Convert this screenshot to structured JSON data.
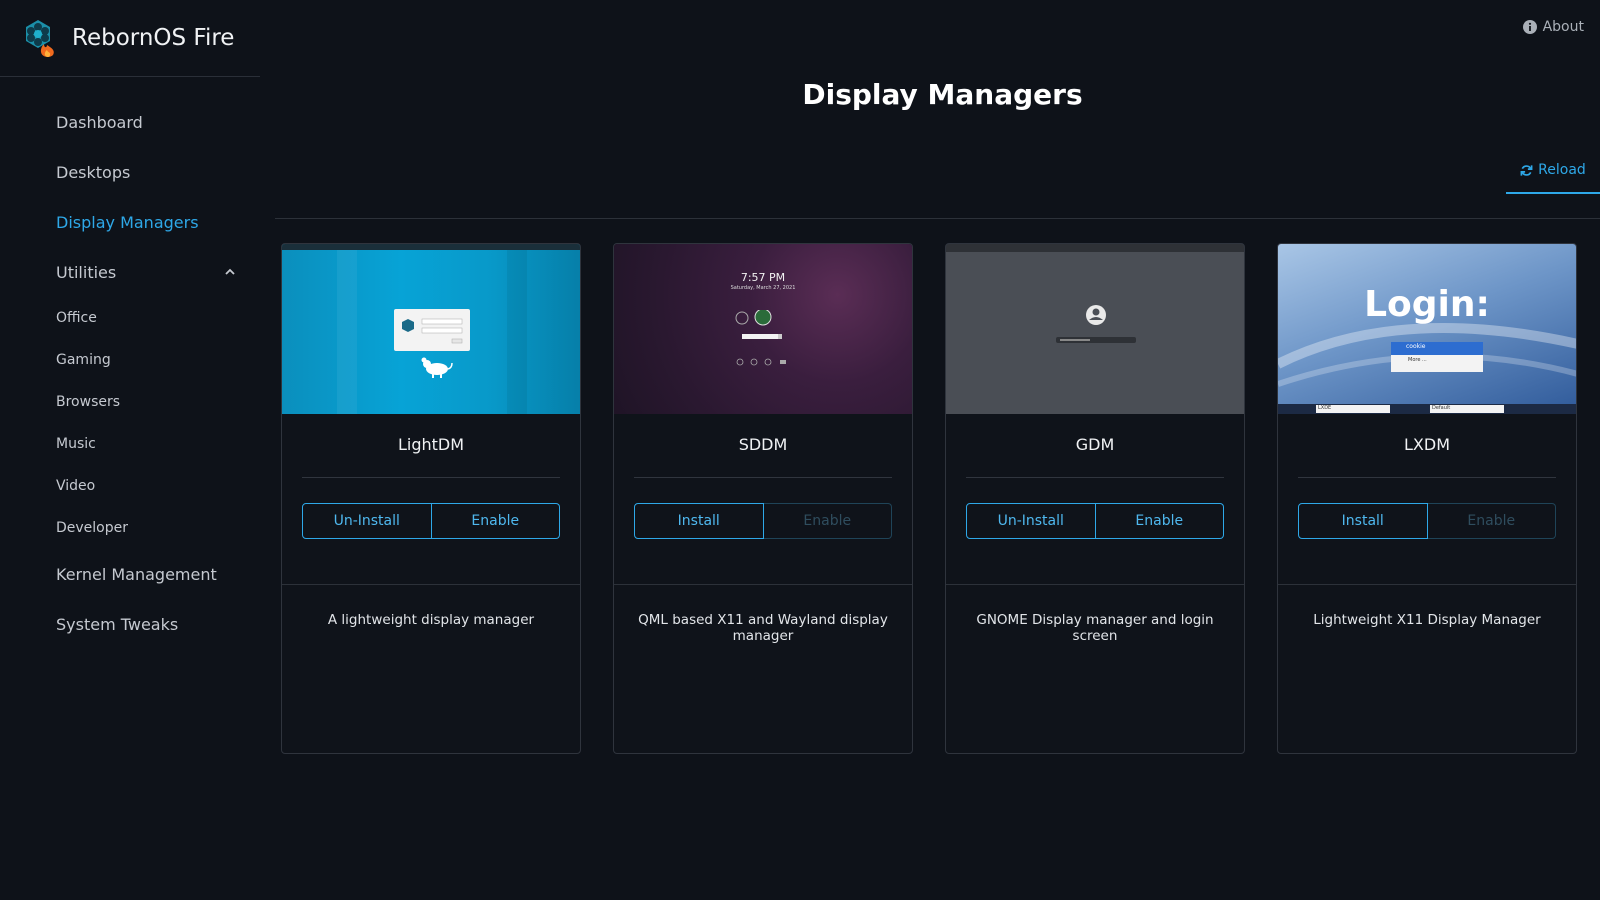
{
  "app": {
    "name": "RebornOS Fire",
    "logo": "rebornos-hexagon-flame-logo"
  },
  "header": {
    "about_label": "About",
    "page_title": "Display Managers",
    "reload_label": "Reload"
  },
  "sidebar": {
    "items": [
      {
        "label": "Dashboard",
        "active": false
      },
      {
        "label": "Desktops",
        "active": false
      },
      {
        "label": "Display Managers",
        "active": true
      },
      {
        "label": "Utilities",
        "expanded": true
      },
      {
        "label": "Office"
      },
      {
        "label": "Gaming"
      },
      {
        "label": "Browsers"
      },
      {
        "label": "Music"
      },
      {
        "label": "Video"
      },
      {
        "label": "Developer"
      },
      {
        "label": "Kernel Management"
      },
      {
        "label": "System Tweaks"
      }
    ]
  },
  "cards": [
    {
      "name": "LightDM",
      "primary_label": "Un-Install",
      "secondary_label": "Enable",
      "secondary_enabled": true,
      "description": "A lightweight display manager"
    },
    {
      "name": "SDDM",
      "primary_label": "Install",
      "secondary_label": "Enable",
      "secondary_enabled": false,
      "description": "QML based X11 and Wayland display manager",
      "preview_time": "7:57 PM",
      "preview_date": "Saturday, March 27, 2021"
    },
    {
      "name": "GDM",
      "primary_label": "Un-Install",
      "secondary_label": "Enable",
      "secondary_enabled": true,
      "description": "GNOME Display manager and login screen"
    },
    {
      "name": "LXDM",
      "primary_label": "Install",
      "secondary_label": "Enable",
      "secondary_enabled": false,
      "description": "Lightweight X11 Display Manager",
      "preview_heading": "Login:",
      "preview_user": "cookie",
      "preview_more": "More ...",
      "preview_session": "LXDE",
      "preview_language": "Default"
    }
  ],
  "colors": {
    "background": "#0e1219",
    "accent": "#2ea8e8",
    "text": "#e6e8eb"
  }
}
